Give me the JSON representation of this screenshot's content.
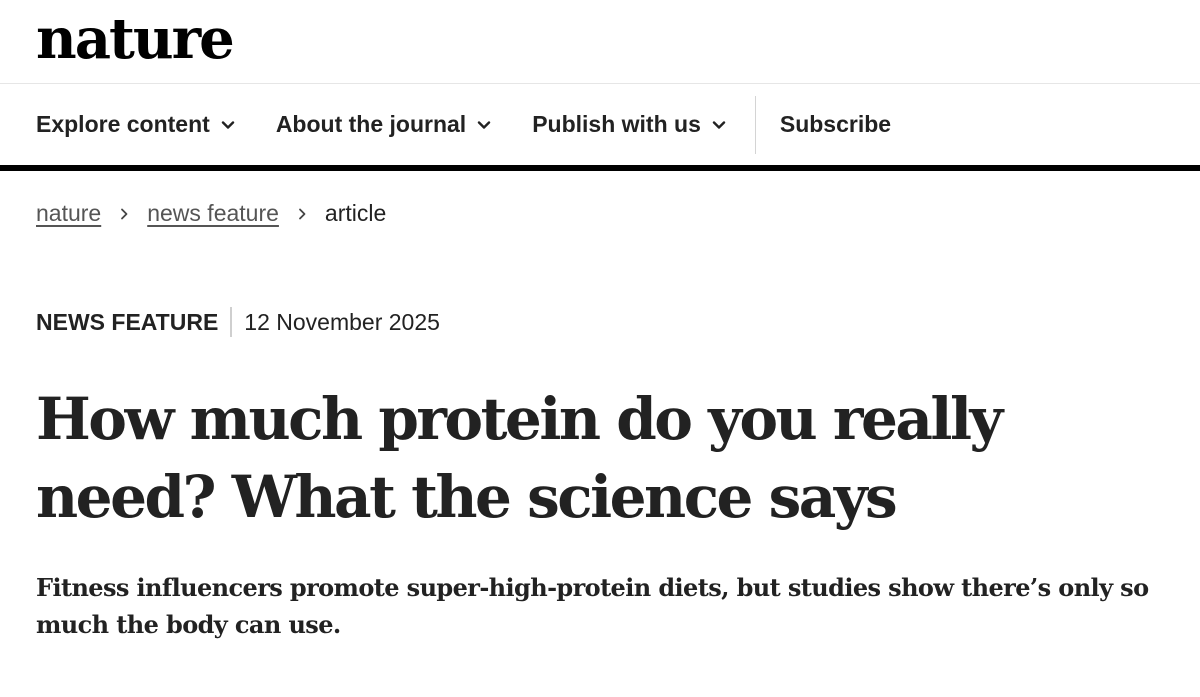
{
  "header": {
    "logo_text": "nature"
  },
  "nav": {
    "items": [
      {
        "label": "Explore content",
        "icon": "chevron-down-icon"
      },
      {
        "label": "About the journal",
        "icon": "chevron-down-icon"
      },
      {
        "label": "Publish with us",
        "icon": "chevron-down-icon"
      }
    ],
    "subscribe_label": "Subscribe"
  },
  "breadcrumb": {
    "items": [
      {
        "label": "nature"
      },
      {
        "label": "news feature"
      }
    ],
    "current": "article",
    "separator_icon": "chevron-right-icon"
  },
  "article": {
    "type": "NEWS FEATURE",
    "date": "12 November 2025",
    "title": "How much protein do you really need? What the science says",
    "standfirst": "Fitness influencers promote super-high-protein diets, but studies show there’s only so much the body can use."
  },
  "colors": {
    "text": "#222222",
    "link_muted": "#555555",
    "nav_rule": "#000000",
    "divider": "#d4d4d4"
  }
}
